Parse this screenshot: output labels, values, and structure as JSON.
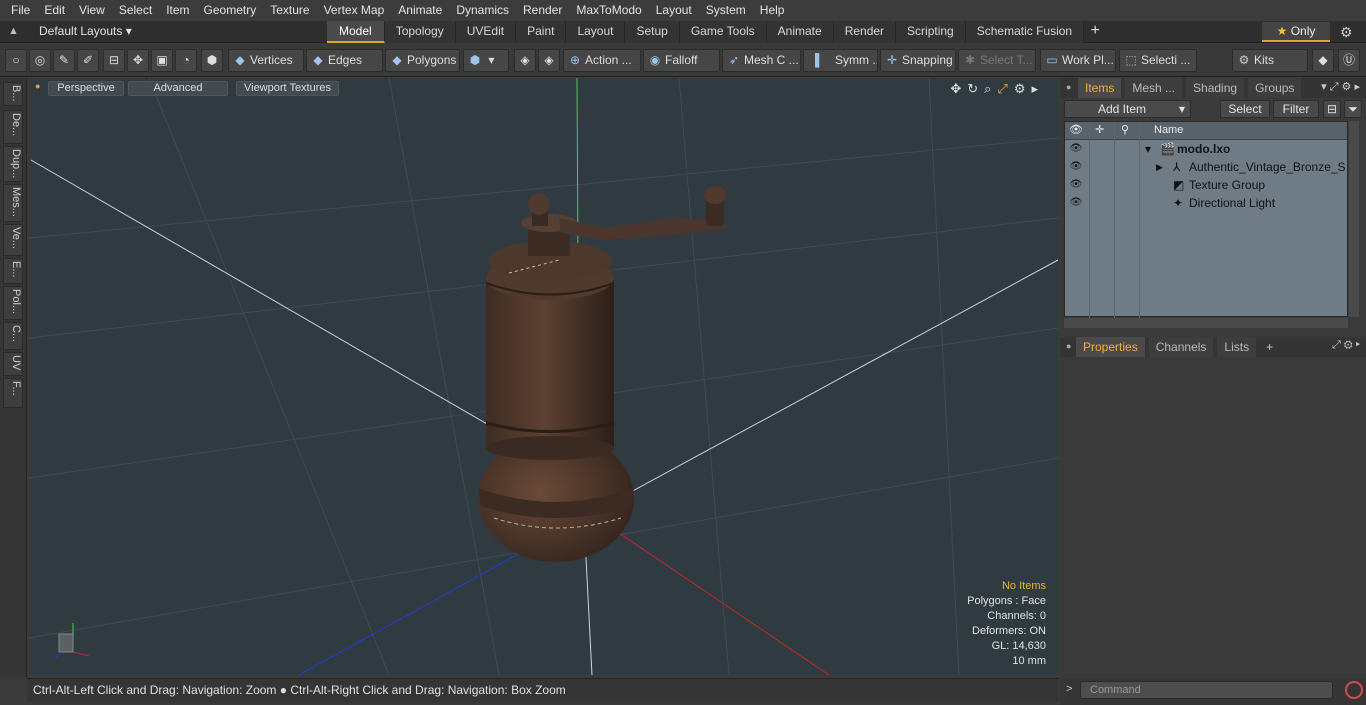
{
  "menu": [
    "File",
    "Edit",
    "View",
    "Select",
    "Item",
    "Geometry",
    "Texture",
    "Vertex Map",
    "Animate",
    "Dynamics",
    "Render",
    "MaxToModo",
    "Layout",
    "System",
    "Help"
  ],
  "layout_selector": "Default Layouts",
  "tabs": [
    {
      "label": "Model",
      "active": true
    },
    {
      "label": "Topology"
    },
    {
      "label": "UVEdit"
    },
    {
      "label": "Paint"
    },
    {
      "label": "Layout"
    },
    {
      "label": "Setup"
    },
    {
      "label": "Game Tools"
    },
    {
      "label": "Animate"
    },
    {
      "label": "Render"
    },
    {
      "label": "Scripting"
    },
    {
      "label": "Schematic Fusion"
    }
  ],
  "only_label": "Only",
  "toolbar": {
    "vertices": "Vertices",
    "edges": "Edges",
    "polygons": "Polygons",
    "action": "Action ...",
    "falloff": "Falloff",
    "mesh": "Mesh C ...",
    "symm": "Symm ...",
    "snapping": "Snapping",
    "select_t": "Select T...",
    "work_pl": "Work Pl...",
    "selecti": "Selecti ...",
    "kits": "Kits"
  },
  "left_strip": [
    "B...",
    "De...",
    "Dup...",
    "Mes...",
    "Ve...",
    "E...",
    "Pol...",
    "C...",
    "UV",
    "F..."
  ],
  "viewport": {
    "perspective": "Perspective",
    "advanced": "Advanced",
    "viewport_textures": "Viewport Textures",
    "stats": {
      "items": "No Items",
      "polygons": "Polygons : Face",
      "channels": "Channels: 0",
      "deformers": "Deformers: ON",
      "gl": "GL: 14,630",
      "scale": "10 mm"
    }
  },
  "status_text": "Ctrl-Alt-Left Click and Drag: Navigation: Zoom ● Ctrl-Alt-Right Click and Drag: Navigation: Box Zoom",
  "items_panel": {
    "tabs": [
      "Items",
      "Mesh ...",
      "Shading",
      "Groups"
    ],
    "add_item": "Add Item",
    "select": "Select",
    "filter": "Filter",
    "name_col": "Name",
    "rows": [
      {
        "label": "modo.lxo",
        "bold": true
      },
      {
        "label": "Authentic_Vintage_Bronze_S ..."
      },
      {
        "label": "Texture Group"
      },
      {
        "label": "Directional Light"
      }
    ]
  },
  "props_tabs": [
    "Properties",
    "Channels",
    "Lists"
  ],
  "command_placeholder": "Command",
  "colors": {
    "accent": "#e3a33a",
    "viewport_bg": "#2f3a41",
    "tree_bg": "#6f7c86"
  }
}
